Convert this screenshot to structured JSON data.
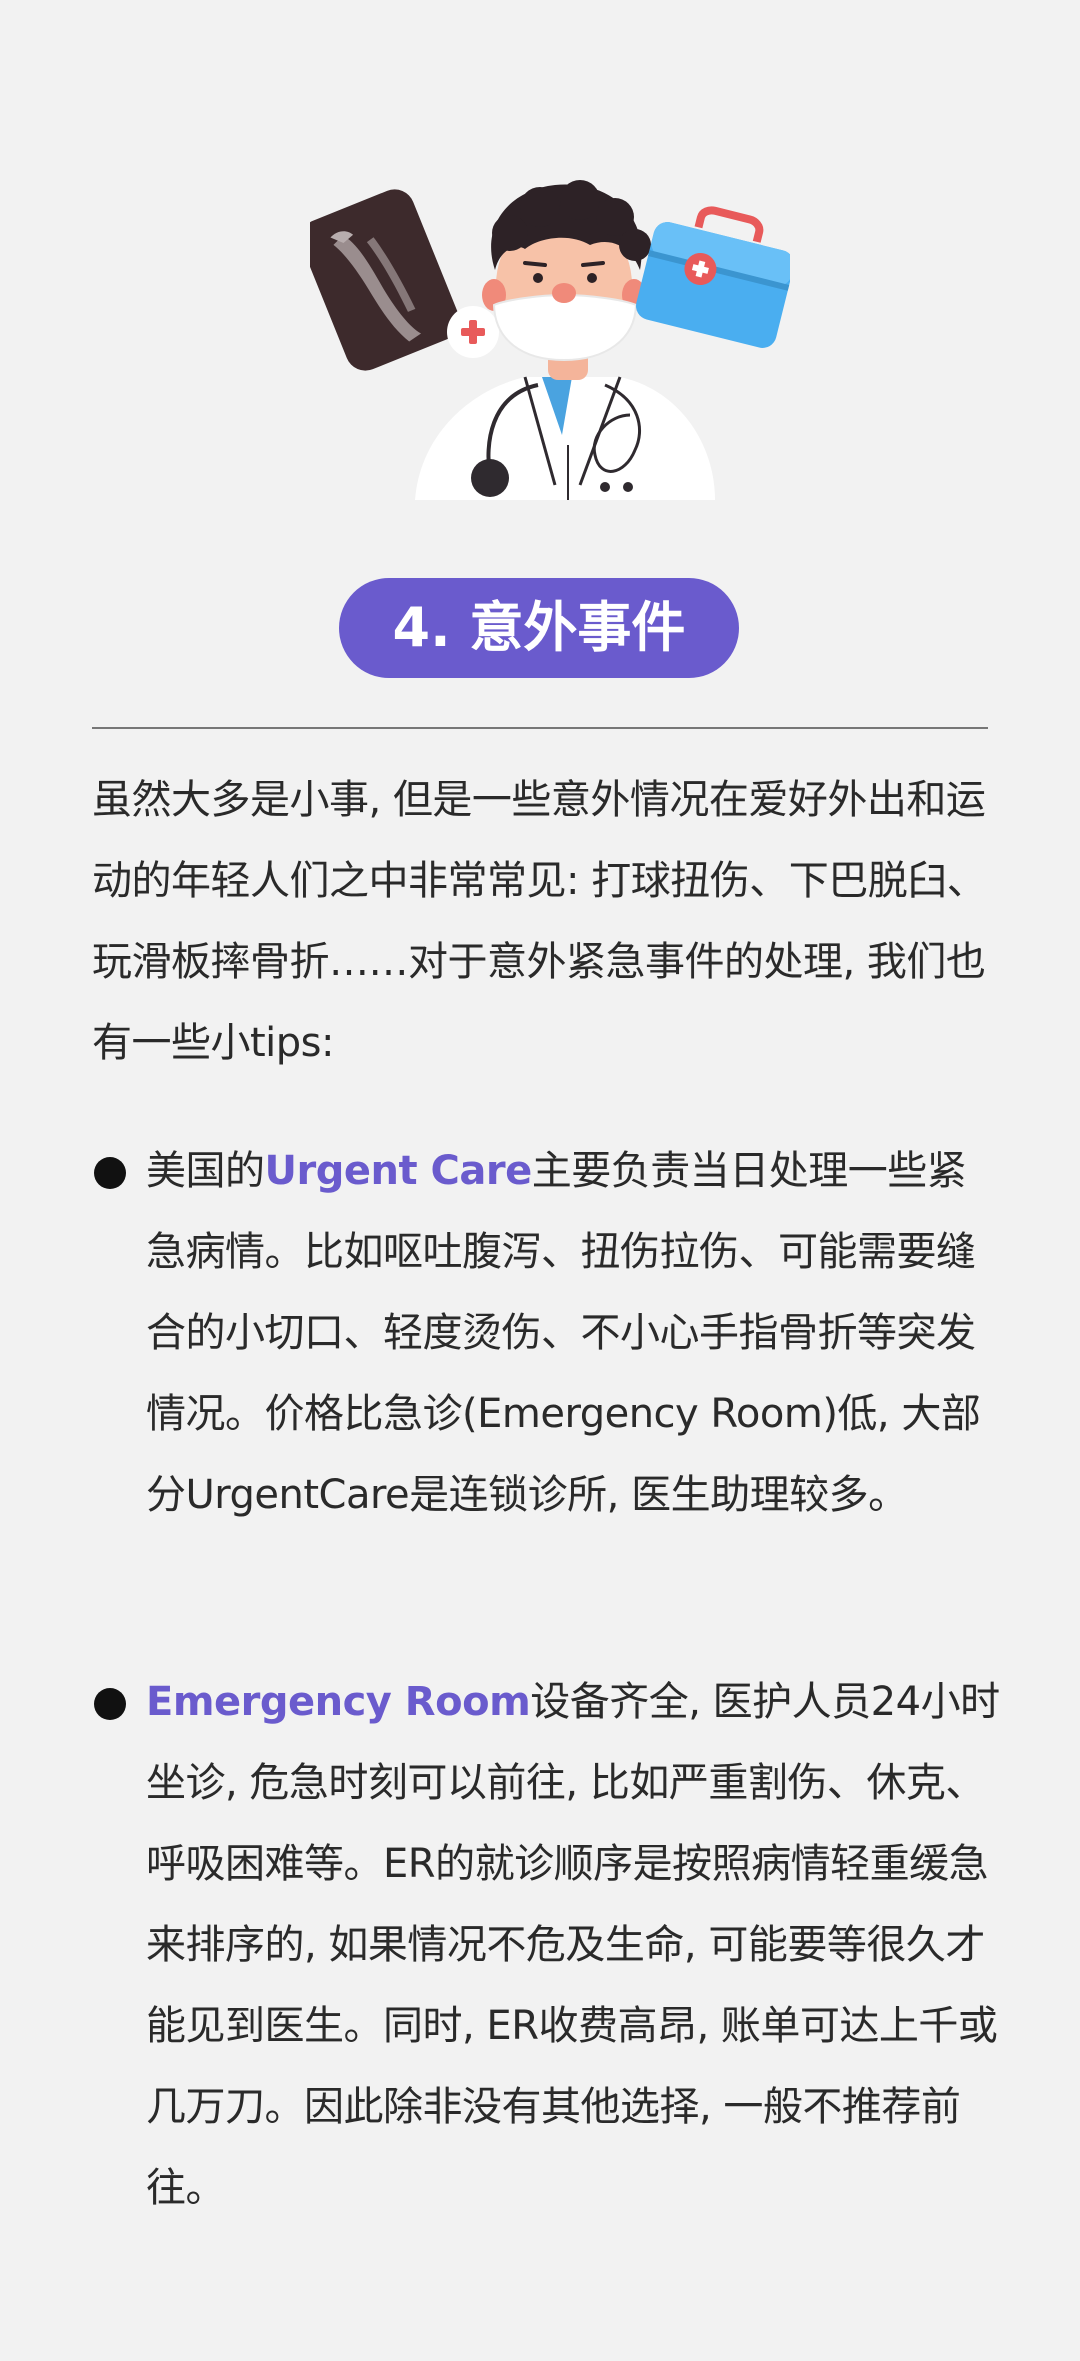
{
  "section": {
    "title": "4. 意外事件"
  },
  "intro": {
    "text": "虽然大多是小事, 但是一些意外情况在爱好外出和运动的年轻人们之中非常常见: 打球扭伤、下巴脱臼、玩滑板摔骨折……对于意外紧急事件的处理, 我们也有一些小tips:"
  },
  "bullets": [
    {
      "prefix": "美国的",
      "highlight": "Urgent Care",
      "text": "主要负责当日处理一些紧急病情。比如呕吐腹泻、扭伤拉伤、可能需要缝合的小切口、轻度烫伤、不小心手指骨折等突发情况。价格比急诊(Emergency Room)低, 大部分UrgentCare是连锁诊所, 医生助理较多。"
    },
    {
      "prefix": "",
      "highlight": "Emergency Room",
      "text": "设备齐全, 医护人员24小时坐诊, 危急时刻可以前往, 比如严重割伤、休克、呼吸困难等。ER的就诊顺序是按照病情轻重缓急来排序的, 如果情况不危及生命, 可能要等很久才能见到医生。同时, ER收费高昂, 账单可达上千或几万刀。因此除非没有其他选择, 一般不推荐前往。"
    }
  ],
  "colors": {
    "accent": "#6a5bcd",
    "background": "#f2f2f2",
    "text": "#2a2a2a"
  },
  "illustration": {
    "icons": [
      "doctor-icon",
      "xray-film-icon",
      "first-aid-kit-icon",
      "stethoscope-icon"
    ]
  }
}
